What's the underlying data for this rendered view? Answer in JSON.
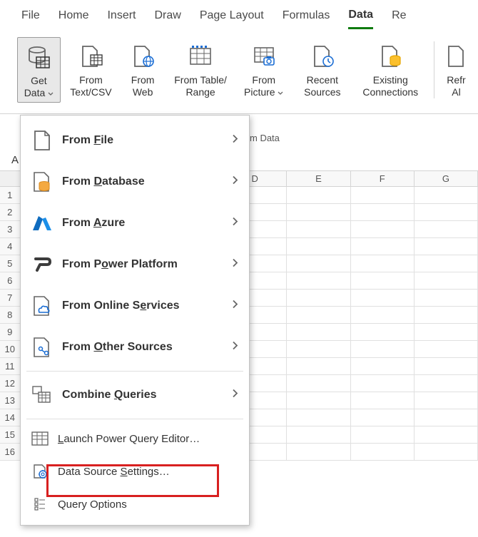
{
  "tabs": {
    "file": "File",
    "home": "Home",
    "insert": "Insert",
    "draw": "Draw",
    "pageLayout": "Page Layout",
    "formulas": "Formulas",
    "data": "Data",
    "review": "Re"
  },
  "ribbon": {
    "getData": "Get Data",
    "fromTextCsv": "From Text/CSV",
    "fromWeb": "From Web",
    "fromTableRange": "From Table/ Range",
    "fromPicture": "From Picture",
    "recentSources": "Recent Sources",
    "existingConnections": "Existing Connections",
    "refreshAll": "Refr Al",
    "sectionLabel": "m Data"
  },
  "nameBox": "A",
  "columns": [
    "D",
    "E",
    "F",
    "G"
  ],
  "rows": [
    "1",
    "2",
    "3",
    "4",
    "5",
    "6",
    "7",
    "8",
    "9",
    "10",
    "11",
    "12",
    "13",
    "14",
    "15",
    "16"
  ],
  "menu": {
    "fromFile": "From File",
    "fromDatabase": "From Database",
    "fromAzure": "From Azure",
    "fromPowerPlatform": "From Power Platform",
    "fromOnlineServices": "From Online Services",
    "fromOtherSources": "From Other Sources",
    "combineQueries": "Combine Queries",
    "launchPQE": "Launch Power Query Editor…",
    "dataSourceSettings": "Data Source Settings…",
    "queryOptions": "Query Options"
  },
  "accessKeys": {
    "fromFile": "F",
    "fromDatabase": "D",
    "fromAzure": "A",
    "fromPowerPlatform": "o",
    "fromOnlineServices": "e",
    "fromOtherSources": "O",
    "combineQueries": "Q",
    "launchPQE": "L",
    "dataSourceSettings": "S",
    "queryOptions": "Q"
  }
}
